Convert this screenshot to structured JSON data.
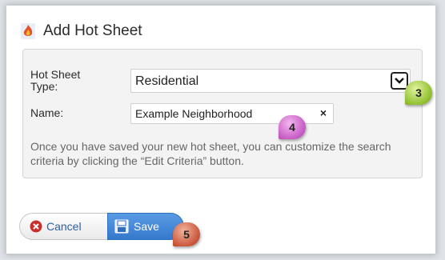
{
  "dialog": {
    "title": "Add Hot Sheet",
    "hot_sheet_type": {
      "label_line1": "Hot Sheet",
      "label_line2": "Type:",
      "value": "Residential"
    },
    "name": {
      "label": "Name:",
      "value": "Example Neighborhood",
      "clear": "×"
    },
    "help_text": "Once you have saved your new hot sheet, you can customize the search criteria by clicking the “Edit Criteria” button."
  },
  "buttons": {
    "cancel": "Cancel",
    "save": "Save"
  },
  "markers": [
    "3",
    "4",
    "5"
  ],
  "colors": {
    "save_blue": "#3579cc",
    "cancel_red": "#c9302c",
    "marker_green": "#8fbf2e",
    "marker_pink": "#c65bc4",
    "marker_red": "#c9563a"
  }
}
